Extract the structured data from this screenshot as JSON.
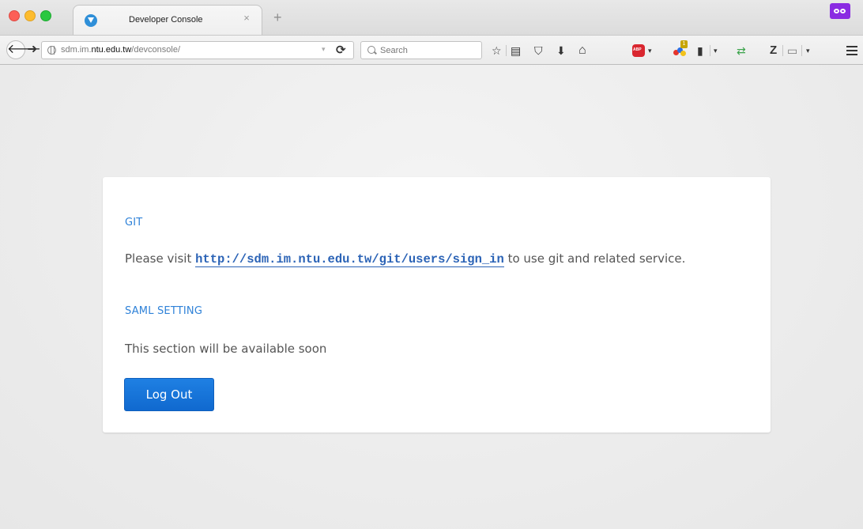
{
  "browser": {
    "tab": {
      "title": "Developer Console",
      "close_glyph": "×"
    },
    "newtab_glyph": "+",
    "nav": {
      "back_glyph": "🡐",
      "forward_glyph": "➜"
    },
    "url": {
      "prefix": "sdm.im.",
      "host": "ntu.edu.tw",
      "path": "/devconsole/"
    },
    "search": {
      "placeholder": "Search"
    },
    "toolbar_glyphs": {
      "bookmark": "☆",
      "reading_list": "▤",
      "pocket": "⛉",
      "download": "⬇",
      "home": "⌂",
      "sync": "⇄",
      "zotero": "Z",
      "page": "▭",
      "dropdown": "▾"
    },
    "extension_badge": "1"
  },
  "page": {
    "git": {
      "heading": "GIT",
      "text_before": "Please visit ",
      "link": "http://sdm.im.ntu.edu.tw/git/users/sign_in",
      "text_after": " to use git and related service."
    },
    "saml": {
      "heading": "SAML SETTING",
      "text": "This section will be available soon"
    },
    "logout_label": "Log Out"
  },
  "colors": {
    "accent": "#2f82d8",
    "link": "#2b63b6",
    "button": "#1069cf"
  }
}
